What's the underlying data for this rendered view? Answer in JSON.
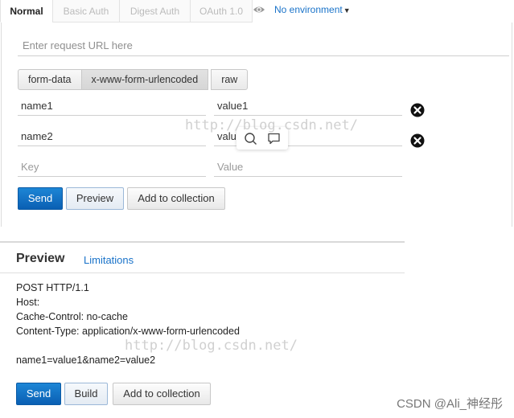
{
  "tabs": [
    {
      "label": "Normal",
      "active": true
    },
    {
      "label": "Basic Auth",
      "active": false
    },
    {
      "label": "Digest Auth",
      "active": false
    },
    {
      "label": "OAuth 1.0",
      "active": false
    }
  ],
  "environment": {
    "icon": "eye-icon",
    "label": "No environment"
  },
  "url": {
    "placeholder": "Enter request URL here",
    "value": ""
  },
  "body_modes": {
    "options": [
      "form-data",
      "x-www-form-urlencoded",
      "raw"
    ],
    "selected": "x-www-form-urlencoded"
  },
  "params": [
    {
      "key": "name1",
      "value": "value1",
      "deletable": true
    },
    {
      "key": "name2",
      "value": "value2",
      "deletable": true
    },
    {
      "key": "",
      "value": "",
      "key_placeholder": "Key",
      "value_placeholder": "Value",
      "deletable": false
    }
  ],
  "actions": {
    "send": "Send",
    "preview": "Preview",
    "add_to_collection": "Add to collection"
  },
  "preview": {
    "title": "Preview",
    "link": "Limitations",
    "lines": [
      "POST HTTP/1.1",
      "Host:",
      "Cache-Control: no-cache",
      "Content-Type: application/x-www-form-urlencoded",
      "",
      "name1=value1&name2=value2"
    ],
    "actions": {
      "send": "Send",
      "build": "Build",
      "add_to_collection": "Add to collection"
    }
  },
  "watermarks": [
    "http://blog.csdn.net/",
    "http://blog.csdn.net/"
  ],
  "credit": "CSDN @Ali_神经彤",
  "colors": {
    "accent": "#1a73c9",
    "primary_button": "#0a5fb3"
  }
}
